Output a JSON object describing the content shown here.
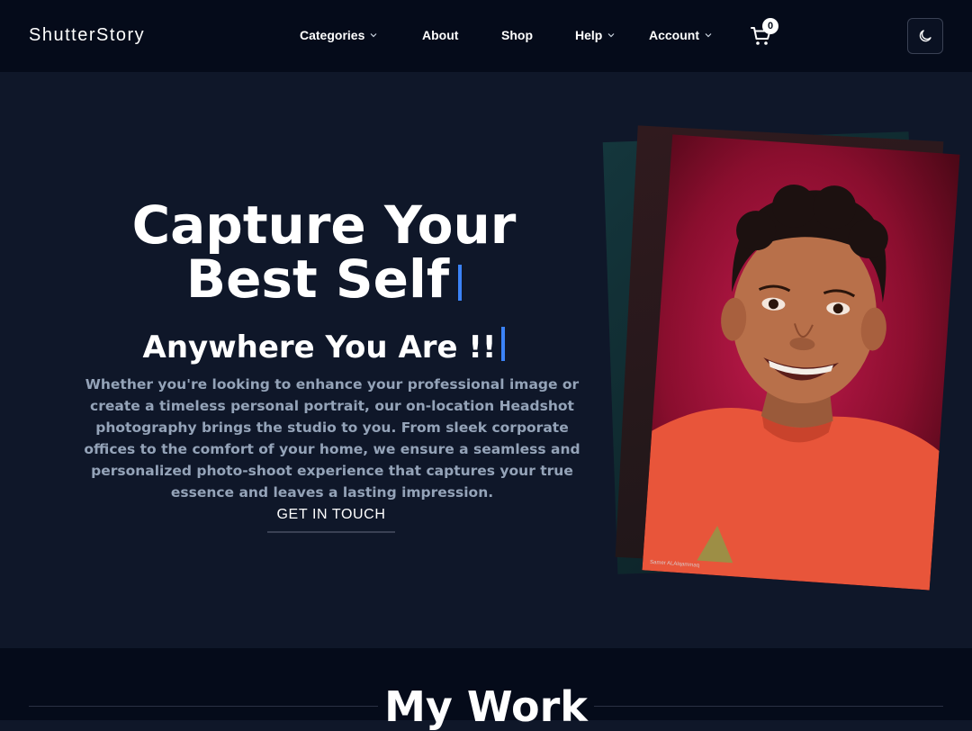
{
  "header": {
    "brand": "ShutterStory",
    "nav": [
      {
        "label": "Categories",
        "dropdown": true
      },
      {
        "label": "About",
        "dropdown": false
      },
      {
        "label": "Shop",
        "dropdown": false
      },
      {
        "label": "Help",
        "dropdown": true
      },
      {
        "label": "Account",
        "dropdown": true
      }
    ],
    "cart_count": "0",
    "theme_icon": "moon-icon"
  },
  "hero": {
    "title_line1": "Capture Your",
    "title_line2": "Best Self",
    "subtitle": "Anywhere You Are !!",
    "description": "Whether you're looking to enhance your professional image or create a timeless personal portrait, our on-location Headshot photography brings the studio to you. From sleek corporate offices to the comfort of your home, we ensure a seamless and personalized photo-shoot experience that captures your true essence and leaves a lasting impression.",
    "cta_label": "GET IN TOUCH",
    "photo_watermark": "Samer ALAlqammaq"
  },
  "work": {
    "title": "My Work"
  },
  "colors": {
    "nav_bg": "#050b1a",
    "hero_bg": "#0f1729",
    "accent": "#3b82f6",
    "muted_text": "#94a3b8"
  }
}
